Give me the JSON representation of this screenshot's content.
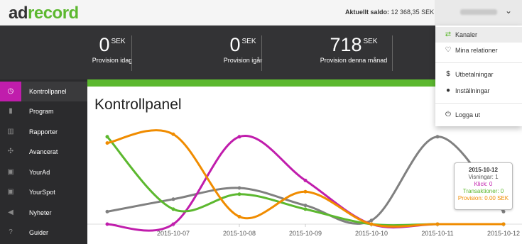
{
  "logo": {
    "part1": "ad",
    "part2": "record"
  },
  "header": {
    "saldo_label": "Aktuellt saldo:",
    "saldo_value": "12 368,35 SEK"
  },
  "stats": [
    {
      "value": "0",
      "unit": "SEK",
      "label": "Provision idag"
    },
    {
      "value": "0",
      "unit": "SEK",
      "label": "Provision igår"
    },
    {
      "value": "718",
      "unit": "SEK",
      "label": "Provision denna månad"
    }
  ],
  "sidebar": {
    "items": [
      {
        "label": "Kontrollpanel",
        "icon": "dashboard-icon",
        "glyph": "◷"
      },
      {
        "label": "Program",
        "icon": "bookmark-icon",
        "glyph": "▮"
      },
      {
        "label": "Rapporter",
        "icon": "bar-chart-icon",
        "glyph": "▥"
      },
      {
        "label": "Avancerat",
        "icon": "crosshair-icon",
        "glyph": "✣"
      },
      {
        "label": "YourAd",
        "icon": "yourad-icon",
        "glyph": "▣"
      },
      {
        "label": "YourSpot",
        "icon": "yourspot-icon",
        "glyph": "▣"
      },
      {
        "label": "Nyheter",
        "icon": "megaphone-icon",
        "glyph": "◀"
      },
      {
        "label": "Guider",
        "icon": "help-icon",
        "glyph": "?"
      }
    ]
  },
  "main": {
    "title": "Kontrollpanel"
  },
  "dropdown": {
    "items": [
      {
        "label": "Kanaler",
        "icon": "swap-icon",
        "glyph": "⇄"
      },
      {
        "label": "Mina relationer",
        "icon": "heart-icon",
        "glyph": "♡"
      },
      {
        "label": "Utbetalningar",
        "icon": "dollar-icon",
        "glyph": "$"
      },
      {
        "label": "Inställningar",
        "icon": "user-icon",
        "glyph": "●"
      },
      {
        "label": "Logga ut",
        "icon": "power-icon",
        "glyph": "⏻"
      }
    ]
  },
  "chart_data": {
    "type": "line",
    "categories": [
      "",
      "2015-10-07",
      "2015-10-08",
      "2015-10-09",
      "2015-10-10",
      "2015-10-11",
      "2015-10-12"
    ],
    "series": [
      {
        "key": "visningar",
        "color": "#808080",
        "values": [
          1,
          2,
          2.9,
          1.5,
          0.3,
          7,
          1
        ]
      },
      {
        "key": "klick",
        "color": "#c01dac",
        "values": [
          0,
          0,
          7,
          3.5,
          0,
          0,
          0
        ]
      },
      {
        "key": "transaktioner",
        "color": "#5cb82f",
        "values": [
          7,
          1.2,
          2.4,
          1.2,
          0,
          0,
          0
        ]
      },
      {
        "key": "provision",
        "color": "#f08c00",
        "values": [
          6.5,
          7.2,
          0.6,
          2.6,
          0,
          0,
          0
        ]
      }
    ],
    "ylim": [
      0,
      7.5
    ]
  },
  "tooltip": {
    "date": "2015-10-12",
    "visningar": "Visningar: 1",
    "klick": "Klick: 0",
    "transaktioner": "Transaktioner: 0",
    "provision": "Provision: 0.00 SEK"
  }
}
